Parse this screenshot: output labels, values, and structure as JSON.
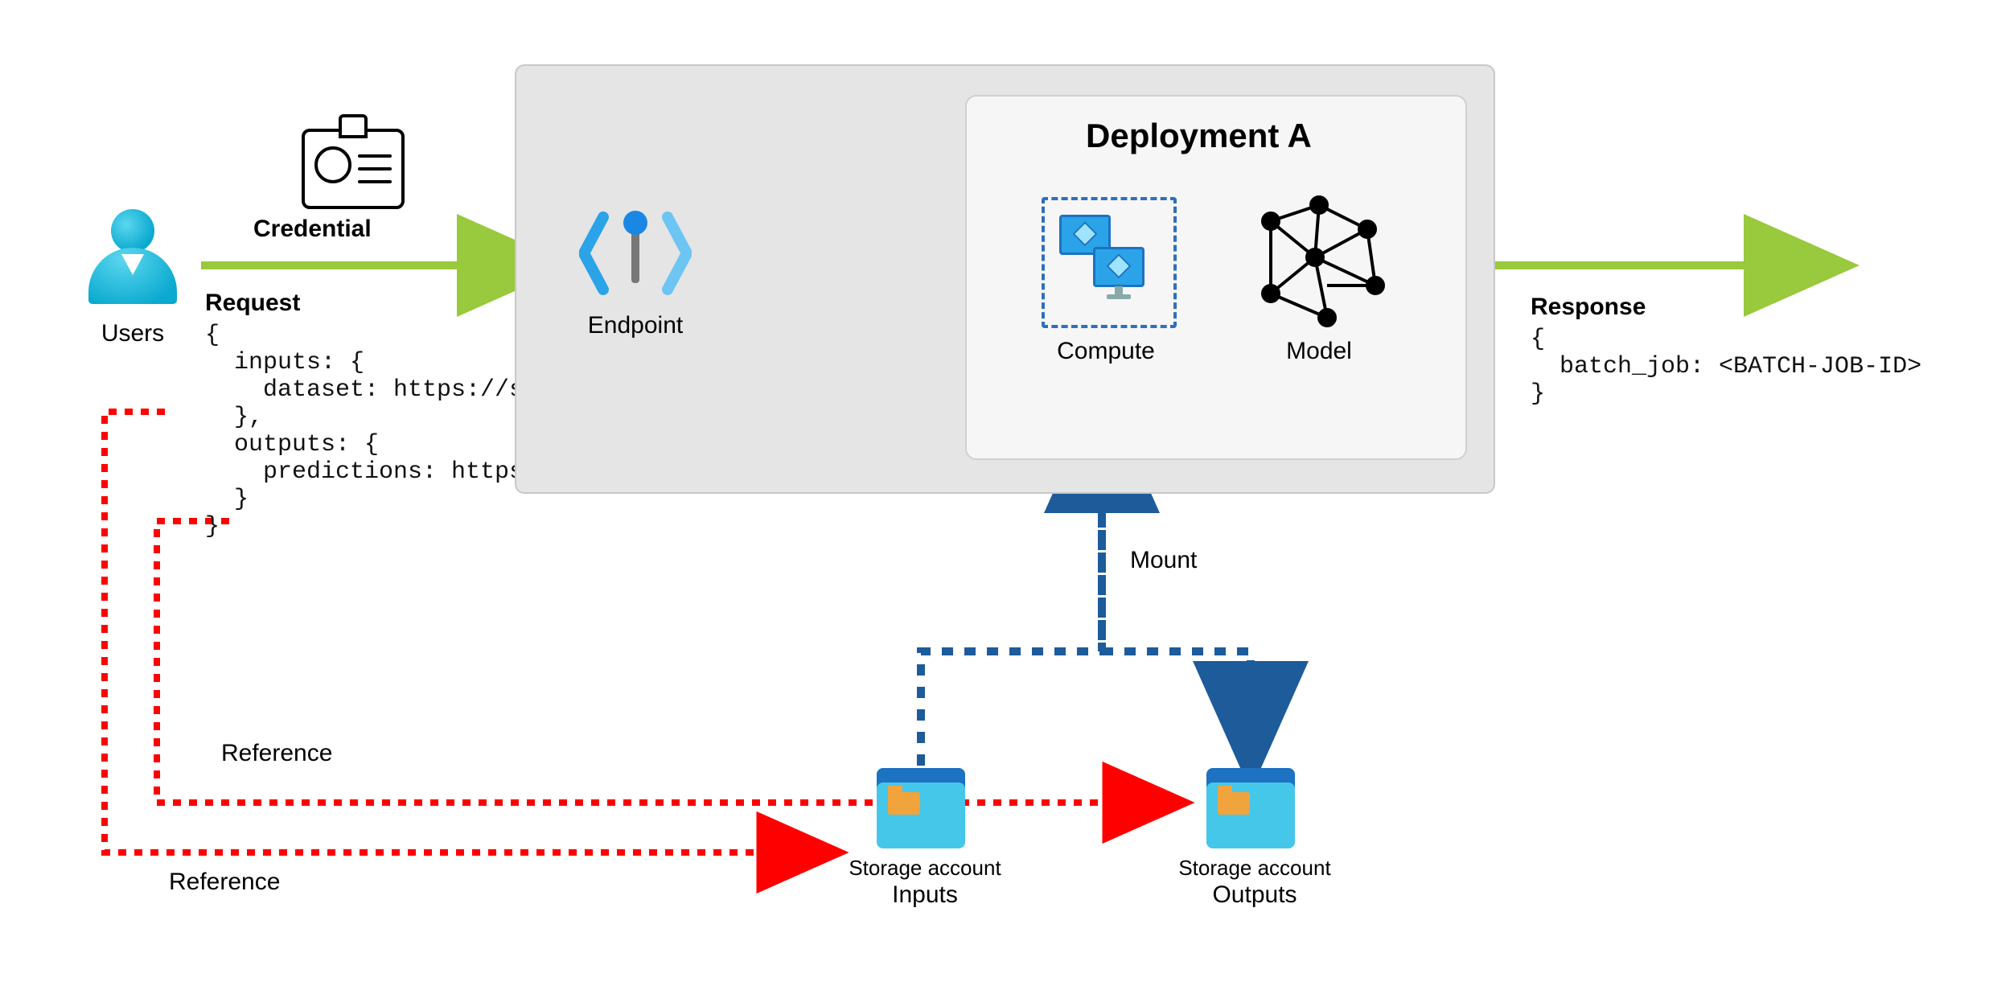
{
  "users_label": "Users",
  "credential_label": "Credential",
  "request_label": "Request",
  "request_code": "{\n  inputs: {\n    dataset: https://storage...\n  },\n  outputs: {\n    predictions: https://storage...\n  }\n}",
  "endpoint_label": "Endpoint",
  "deployment_title": "Deployment A",
  "compute_label": "Compute",
  "model_label": "Model",
  "response_label": "Response",
  "response_code": "{\n  batch_job: <BATCH-JOB-ID>\n}",
  "mount_label": "Mount",
  "reference_label": "Reference",
  "storage_inputs_top": "Storage account",
  "storage_inputs_bottom": "Inputs",
  "storage_outputs_top": "Storage account",
  "storage_outputs_bottom": "Outputs",
  "colors": {
    "flow": "#99c93c",
    "mount": "#1d5b9b",
    "reference": "#ff0000"
  }
}
